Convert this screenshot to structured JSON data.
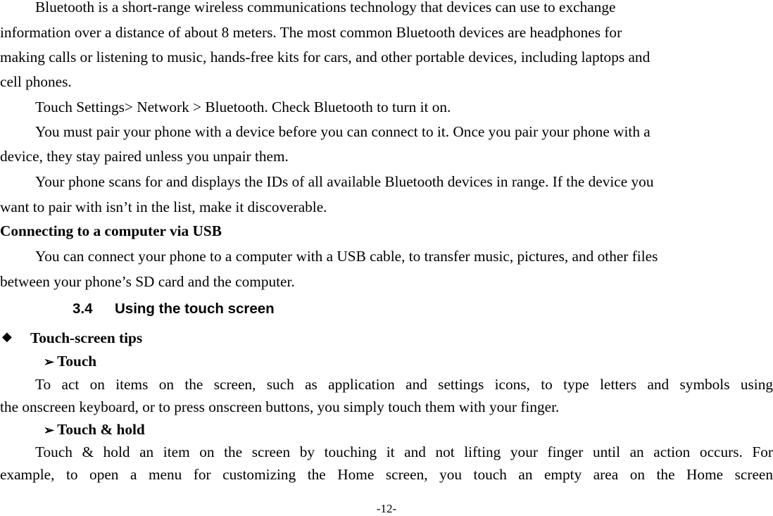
{
  "document": {
    "paragraphs": {
      "p1_l1": "Bluetooth is a short-range wireless communications technology that devices can use to exchange",
      "p1_l2": "information over a distance of about 8 meters. The most common Bluetooth devices are headphones for",
      "p1_l3": "making calls or listening to music, hands-free kits for cars, and other portable devices, including laptops and",
      "p1_l4": "cell phones.",
      "p2_l1": "Touch Settings> Network > Bluetooth. Check Bluetooth to turn it on.",
      "p3_l1": "You must pair your phone with a device before you can connect to it. Once you pair your phone with a",
      "p3_l2": "device, they stay paired unless you unpair them.",
      "p4_l1": "Your phone scans for and displays the IDs of all available Bluetooth devices in range. If the device you",
      "p4_l2": "want to pair with isn’t in the list, make it discoverable.",
      "h_usb": "Connecting to a computer via USB",
      "p5_l1": "You can connect your phone to a computer with a USB cable, to transfer music, pictures, and other files",
      "p5_l2": "between your phone’s SD card and the computer.",
      "section_number": "3.4",
      "section_title": "Using the touch screen",
      "bullet_glyph": "◆",
      "tips_title": "Touch-screen tips",
      "arrow_glyph": "➢",
      "touch_title": "Touch",
      "p6_l1": "To act on items on the screen, such as application and settings icons, to type letters and symbols using",
      "p6_l2": "the onscreen keyboard, or to press onscreen buttons, you simply touch them with your finger.",
      "touch_hold_title": "Touch & hold",
      "p7_l1": "Touch & hold an item on the screen by touching it and not lifting your finger until an action occurs. For",
      "p7_l2": "example, to open a menu for customizing the Home screen, you touch an empty area on the Home screen"
    },
    "page_number": "-12-"
  }
}
